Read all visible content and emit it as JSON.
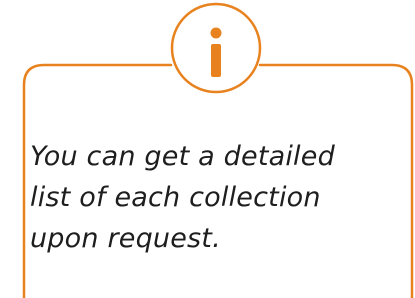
{
  "callout": {
    "icon": "info-icon",
    "icon_glyph": "i",
    "text_lines": [
      "You can get a detailed",
      "list of each collection",
      "upon request."
    ],
    "accent_color": "#E8821E",
    "text_color": "#1E1E1E"
  }
}
